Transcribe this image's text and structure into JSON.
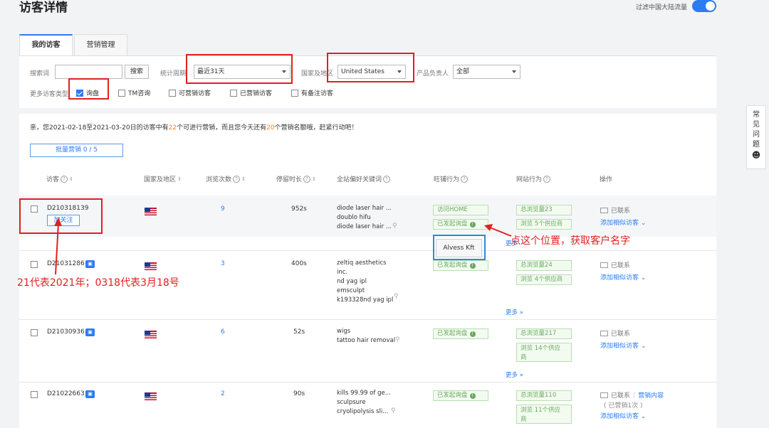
{
  "page": {
    "title": "访客详情",
    "filter_toggle_label": "过滤中国大陆流量",
    "faq_label": [
      "常",
      "见",
      "问",
      "题"
    ]
  },
  "tabs": [
    {
      "label": "我的访客",
      "active": true
    },
    {
      "label": "营销管理",
      "active": false
    }
  ],
  "filters": {
    "search_label": "搜索词",
    "search_value": "",
    "search_button": "搜索",
    "period_label": "统计周期",
    "period_value": "最近31天",
    "region_label": "国家及地区",
    "region_value": "United States",
    "owner_label": "产品负责人",
    "owner_value": "全部",
    "more_types_label": "更多访客类型",
    "checkboxes": [
      {
        "label": "询盘",
        "checked": true
      },
      {
        "label": "TM咨询",
        "checked": false
      },
      {
        "label": "可营销访客",
        "checked": false
      },
      {
        "label": "已营销访客",
        "checked": false
      },
      {
        "label": "有备注访客",
        "checked": false
      }
    ]
  },
  "notice": {
    "prefix": "亲，您2021-02-18至2021-03-20日的访客中有",
    "num1": "22",
    "mid": "个可进行营销，而且您今天还有",
    "num2": "20",
    "suffix": "个营销名额哦，赶紧行动吧！"
  },
  "batch_button": "批量营销  0 / 5",
  "columns": {
    "visitor": "访客",
    "country": "国家及地区",
    "views": "浏览次数",
    "duration": "停留时长",
    "keywords": "全站偏好关键词",
    "wangpu": "旺铺行为",
    "site": "网站行为",
    "ops": "操作"
  },
  "rows": [
    {
      "id": "D210318139",
      "follow_label": "加关注",
      "views": "9",
      "duration": "952s",
      "keywords": [
        "diode laser hair ...",
        "doublo hifu",
        "diode laser hair ..."
      ],
      "wangpu": [
        "访问HOME",
        "已发起询盘"
      ],
      "site": [
        "总浏览量23",
        "浏览 5个供应商"
      ],
      "contact": "已联系",
      "similar": "添加相似访客",
      "more": "更多"
    },
    {
      "id": "D21031286",
      "views": "3",
      "duration": "400s",
      "keywords": [
        "zeltiq aesthetics",
        "inc.",
        "nd yag ipl",
        "emsculpt",
        "k193328nd yag ipl"
      ],
      "wangpu": [
        "已发起询盘"
      ],
      "site": [
        "总浏览量24",
        "浏览 4个供应商"
      ],
      "contact": "已联系",
      "similar": "添加相似访客",
      "more": "更多"
    },
    {
      "id": "D21030936",
      "views": "6",
      "duration": "52s",
      "keywords": [
        "wigs",
        "tattoo hair removal"
      ],
      "wangpu": [
        "已发起询盘"
      ],
      "site": [
        "总浏览量217",
        "浏览 14个供应",
        "商"
      ],
      "contact": "已联系",
      "similar": "添加相似访客",
      "more": "更多"
    },
    {
      "id": "D21022663",
      "views": "2",
      "duration": "90s",
      "keywords": [
        "kills 99.99 of ge...",
        "sculpsure",
        "cryolipolysis sli..."
      ],
      "wangpu": [
        "已发起询盘"
      ],
      "site": [
        "总浏览量110",
        "浏览 11个供应",
        "商"
      ],
      "contact": "已联系",
      "marketing": "营销内容",
      "marketing_count": "( 已营销1次 )",
      "similar": "添加相似访客"
    }
  ],
  "tooltip": {
    "name": "Alvess Kft"
  },
  "annotations": {
    "right": "点这个位置，获取客户名字",
    "left": "21代表2021年；0318代表3月18号"
  },
  "colors": {
    "accent": "#2b7cf0",
    "annotation": "#e02020",
    "tag_green": "#6aa85f"
  }
}
